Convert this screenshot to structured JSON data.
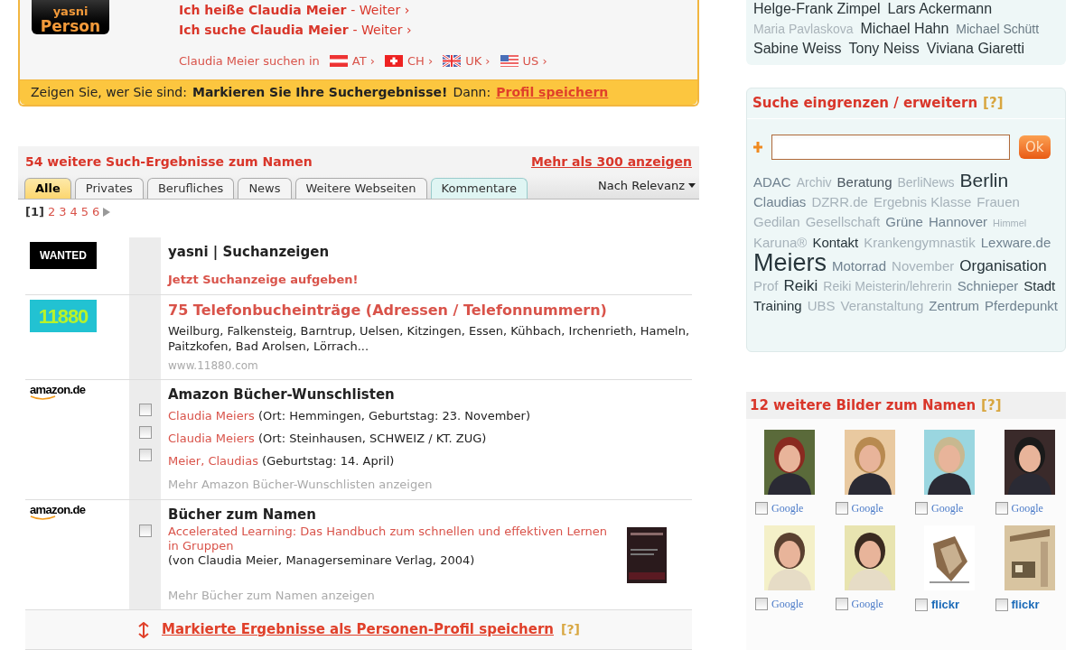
{
  "profile_box": {
    "logo_lines": [
      "yasni",
      "Person"
    ],
    "links": [
      {
        "text": "Ich heiße Claudia Meier",
        "suffix": "- Weiter ›"
      },
      {
        "text": "Ich suche Claudia Meier",
        "suffix": "- Weiter ›"
      }
    ],
    "search_in": {
      "label": "Claudia Meier suchen in",
      "countries": [
        {
          "code": "AT ›",
          "kind": "at"
        },
        {
          "code": "CH ›",
          "kind": "ch"
        },
        {
          "code": "UK ›",
          "kind": "uk"
        },
        {
          "code": "US ›",
          "kind": "us"
        }
      ]
    },
    "notice": {
      "lead": "Zeigen Sie, wer Sie sind:",
      "bold": "Markieren Sie Ihre Suchergebnisse!",
      "then": "Dann:",
      "link": "Profil speichern"
    }
  },
  "results": {
    "title": "54 weitere Such-Ergebnisse zum Namen",
    "more_link": "Mehr als 300 anzeigen",
    "tabs": [
      {
        "label": "Alle",
        "selected": true,
        "kind": "normal"
      },
      {
        "label": "Privates",
        "selected": false,
        "kind": "normal"
      },
      {
        "label": "Berufliches",
        "selected": false,
        "kind": "normal"
      },
      {
        "label": "News",
        "selected": false,
        "kind": "normal"
      },
      {
        "label": "Weitere Webseiten",
        "selected": false,
        "kind": "normal"
      },
      {
        "label": "Kommentare",
        "selected": false,
        "kind": "highlight"
      }
    ],
    "sort": "Nach Relevanz",
    "pagination": {
      "current": "[1]",
      "pages": [
        "2",
        "3",
        "4",
        "5",
        "6"
      ]
    },
    "items": [
      {
        "kind": "ad",
        "logo": "WANTED",
        "title": "yasni | Suchanzeigen",
        "action": "Jetzt Suchanzeige aufgeben!"
      },
      {
        "kind": "phonebook",
        "logo": "11880",
        "title": "75 Telefonbucheinträge (Adressen / Telefonnummern)",
        "text": "Weilburg, Falkensteig, Barntrup, Uelsen, Kitzingen, Essen, Kühbach, Irchenrieth, Hameln, Paitzkofen, Bad Arolsen, Lörrach...",
        "url": "www.11880.com"
      },
      {
        "kind": "list",
        "logo": "amazon.de",
        "title": "Amazon Bücher-Wunschlisten",
        "entries": [
          {
            "link": "Claudia Meiers",
            "detail": "(Ort: Hemmingen, Geburtstag: 23. November)",
            "checked": false
          },
          {
            "link": "Claudia Meiers",
            "detail": "(Ort: Steinhausen, SCHWEIZ / KT. ZUG)",
            "checked": false
          },
          {
            "link": "Meier, Claudias",
            "detail": "(Geburtstag: 14. April)",
            "checked": false
          }
        ],
        "more": "Mehr Amazon Bücher-Wunschlisten anzeigen"
      },
      {
        "kind": "list",
        "logo": "amazon.de",
        "title": "Bücher zum Namen",
        "entries": [
          {
            "link": "Accelerated Learning: Das Handbuch zum schnellen und effektiven Lernen in Gruppen",
            "detail": "(von Claudia Meier, Managerseminare Verlag, 2004)",
            "checked": false,
            "kind": "book"
          }
        ],
        "more": "Mehr Bücher zum Namen anzeigen"
      }
    ],
    "save_bar": {
      "link": "Markierte Ergebnisse als Personen-Profil speichern",
      "help": "[?]"
    }
  },
  "names": [
    {
      "text": "Helge-Frank Zimpel",
      "kind": "large",
      "color": "#2a3438"
    },
    {
      "text": "Lars Ackermann",
      "kind": "large",
      "color": "#2a3438"
    },
    {
      "text": "Maria Pavlaskova",
      "kind": "small",
      "color": "#aab4ba"
    },
    {
      "text": "Michael Hahn",
      "kind": "large",
      "color": "#2a3438"
    },
    {
      "text": "Michael Schütt",
      "kind": "small",
      "color": "#6a7a84"
    },
    {
      "text": "Sabine Weiss",
      "kind": "large",
      "color": "#2a3438"
    },
    {
      "text": "Tony Neiss",
      "kind": "large",
      "color": "#2a3438"
    },
    {
      "text": "Viviana Giaretti",
      "kind": "large",
      "color": "#2a3438"
    }
  ],
  "refine": {
    "title": "Suche eingrenzen / erweitern",
    "help": "[?]",
    "button": "Ok",
    "tags": [
      {
        "text": "ADAC",
        "kind": "medium",
        "color": "#708290"
      },
      {
        "text": "Archiv",
        "kind": "small",
        "color": "#a6b2ba"
      },
      {
        "text": "Beratung",
        "kind": "medium",
        "color": "#4a5660"
      },
      {
        "text": "BerliNews",
        "kind": "small",
        "color": "#a6b2ba"
      },
      {
        "text": "Berlin",
        "kind": "huge",
        "color": "#26343a"
      },
      {
        "text": "Claudias",
        "kind": "medium",
        "color": "#708290"
      },
      {
        "text": "DZRR.de",
        "kind": "medium",
        "color": "#a6b2ba"
      },
      {
        "text": "Ergebnis Klasse",
        "kind": "medium",
        "color": "#a6b2ba"
      },
      {
        "text": "Frauen",
        "kind": "medium",
        "color": "#a6b2ba"
      },
      {
        "text": "Gedilan",
        "kind": "medium",
        "color": "#a6b2ba"
      },
      {
        "text": "Gesellschaft",
        "kind": "medium",
        "color": "#a6b2ba"
      },
      {
        "text": "Grüne",
        "kind": "medium",
        "color": "#708290"
      },
      {
        "text": "Hannover",
        "kind": "medium",
        "color": "#708290"
      },
      {
        "text": "Himmel",
        "kind": "tiny",
        "color": "#a6b2ba"
      },
      {
        "text": "Karuna®",
        "kind": "medium",
        "color": "#a6b2ba"
      },
      {
        "text": "Kontakt",
        "kind": "medium",
        "color": "#26343a"
      },
      {
        "text": "Krankengymnastik",
        "kind": "medium",
        "color": "#a6b2ba"
      },
      {
        "text": "Lexware.de",
        "kind": "medium",
        "color": "#708290"
      },
      {
        "text": "Meiers",
        "kind": "giant",
        "color": "#26343a"
      },
      {
        "text": "Motorrad",
        "kind": "medium",
        "color": "#708290"
      },
      {
        "text": "November",
        "kind": "medium",
        "color": "#a6b2ba"
      },
      {
        "text": "Organisation",
        "kind": "large",
        "color": "#26343a"
      },
      {
        "text": "Prof",
        "kind": "medium",
        "color": "#a6b2ba"
      },
      {
        "text": "Reiki",
        "kind": "large",
        "color": "#26343a"
      },
      {
        "text": "Reiki Meisterin/lehrerin",
        "kind": "small",
        "color": "#a6b2ba"
      },
      {
        "text": "Schnieper",
        "kind": "medium",
        "color": "#708290"
      },
      {
        "text": "Stadt",
        "kind": "medium",
        "color": "#26343a"
      },
      {
        "text": "Training",
        "kind": "medium",
        "color": "#26343a"
      },
      {
        "text": "UBS",
        "kind": "medium",
        "color": "#a6b2ba"
      },
      {
        "text": "Veranstaltung",
        "kind": "medium",
        "color": "#a6b2ba"
      },
      {
        "text": "Zentrum",
        "kind": "medium",
        "color": "#708290"
      },
      {
        "text": "Pferdepunkt",
        "kind": "medium",
        "color": "#708290"
      }
    ]
  },
  "images": {
    "title": "12 weitere Bilder zum Namen",
    "help": "[?]",
    "items": [
      {
        "source": "Google",
        "kind": "google",
        "checked": false
      },
      {
        "source": "Google",
        "kind": "google",
        "checked": false
      },
      {
        "source": "Google",
        "kind": "google",
        "checked": false
      },
      {
        "source": "Google",
        "kind": "google",
        "checked": false
      },
      {
        "source": "Google",
        "kind": "google",
        "checked": false
      },
      {
        "source": "Google",
        "kind": "google",
        "checked": false
      },
      {
        "source": "flickr",
        "kind": "flickr",
        "checked": false
      },
      {
        "source": "flickr",
        "kind": "flickr",
        "checked": false
      }
    ]
  }
}
